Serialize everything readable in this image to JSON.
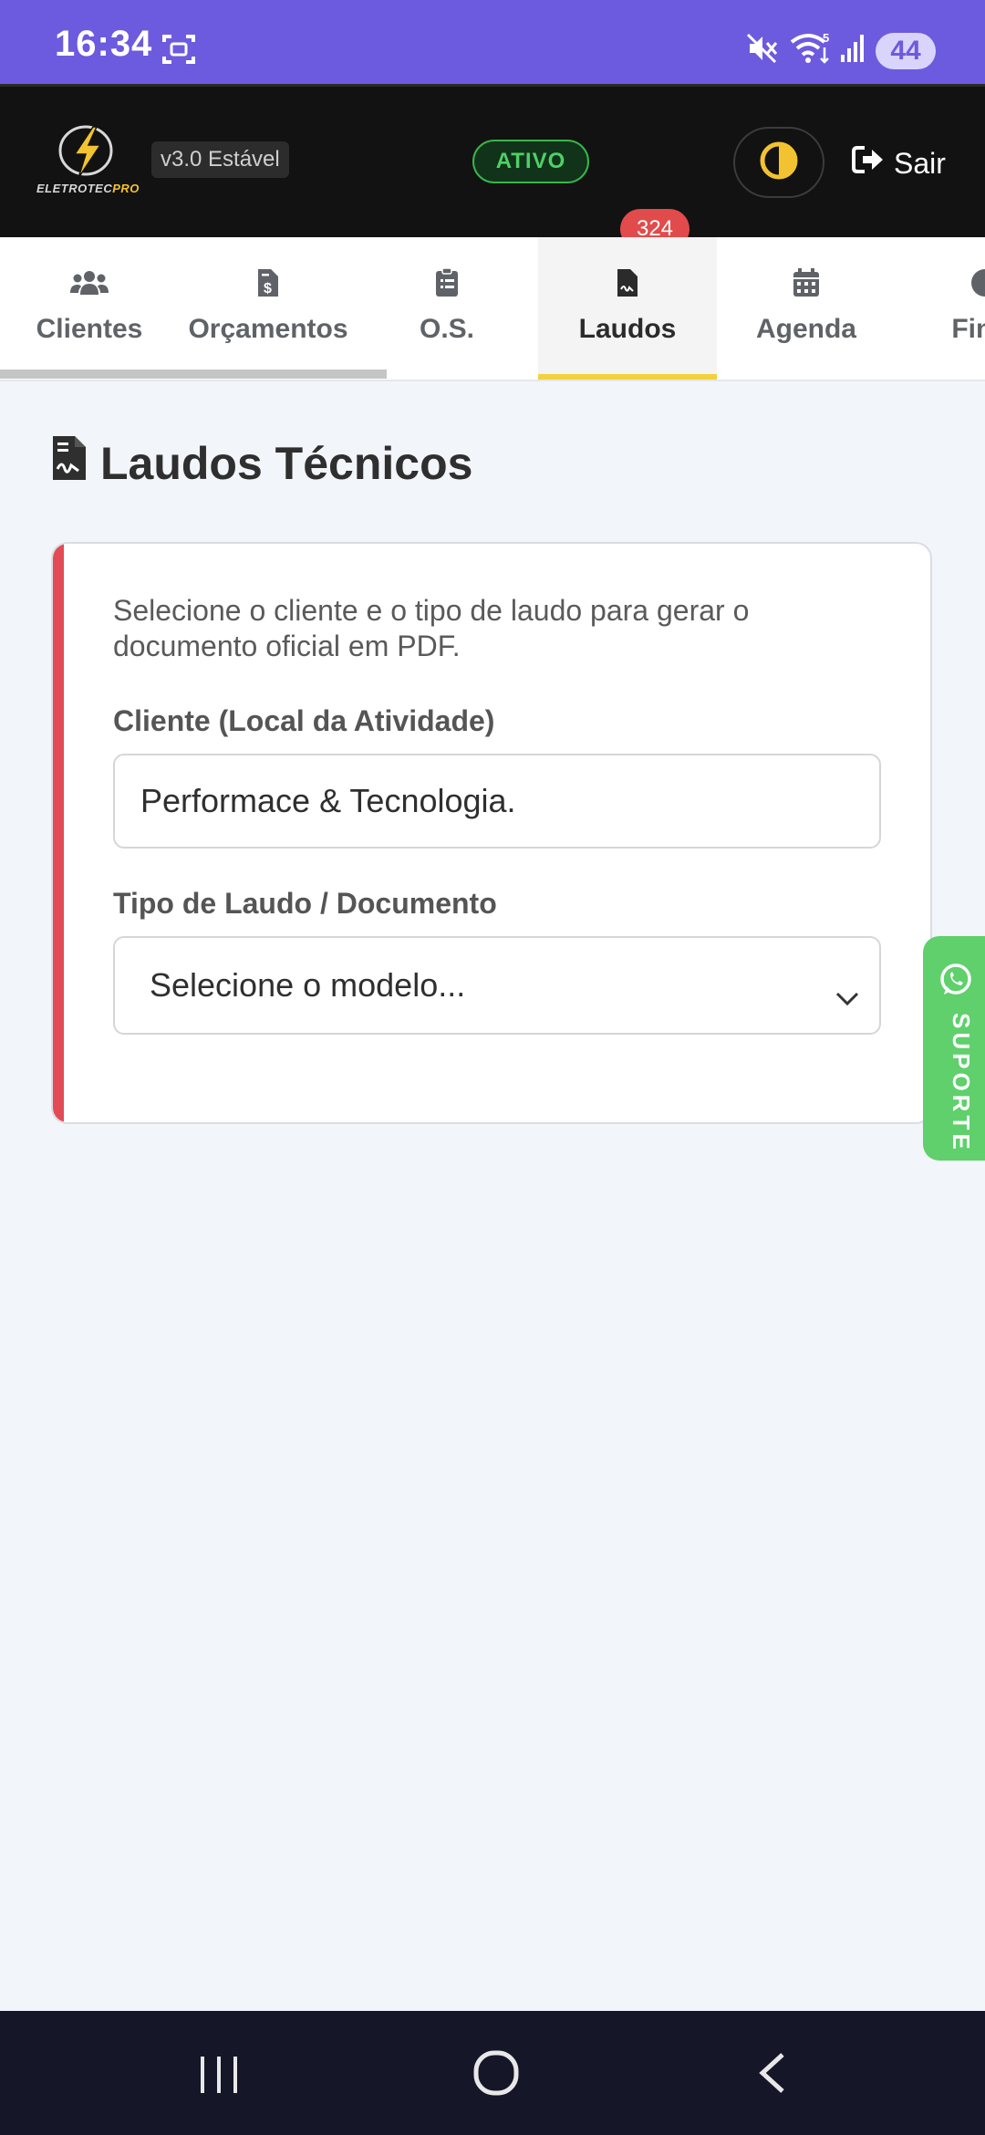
{
  "status_bar": {
    "time": "16:34",
    "battery": "44",
    "icons": [
      "screenshot-icon",
      "mute-icon",
      "wifi-icon",
      "signal-icon"
    ]
  },
  "header": {
    "logo_text_main": "ELETROTEC",
    "logo_text_accent": "PRO",
    "version": "v3.0 Estável",
    "status": "ATIVO",
    "notifications": "324",
    "logout_label": "Sair",
    "colors": {
      "background": "#121212",
      "accent": "#f2c230",
      "status_green": "#39b54a",
      "badge_red": "#e24b4b"
    }
  },
  "tabs": [
    {
      "label": "Clientes",
      "icon": "users-icon"
    },
    {
      "label": "Orçamentos",
      "icon": "invoice-dollar-icon"
    },
    {
      "label": "O.S.",
      "icon": "clipboard-list-icon"
    },
    {
      "label": "Laudos",
      "icon": "file-signature-icon",
      "active": true
    },
    {
      "label": "Agenda",
      "icon": "calendar-icon"
    },
    {
      "label": "Finar",
      "icon": "chart-pie-icon"
    }
  ],
  "main": {
    "title": "Laudos Técnicos",
    "description": "Selecione o cliente e o tipo de laudo para gerar o documento oficial em PDF.",
    "client_label": "Cliente (Local da Atividade)",
    "client_value": "Performace & Tecnologia.",
    "doc_type_label": "Tipo de Laudo / Documento",
    "doc_type_selected": "Selecione o modelo..."
  },
  "support": {
    "label": "SUPORTE",
    "icon": "whatsapp-icon",
    "color": "#5fd06c"
  },
  "nav": {
    "icons": [
      "recent-apps-icon",
      "home-icon",
      "back-icon"
    ]
  }
}
